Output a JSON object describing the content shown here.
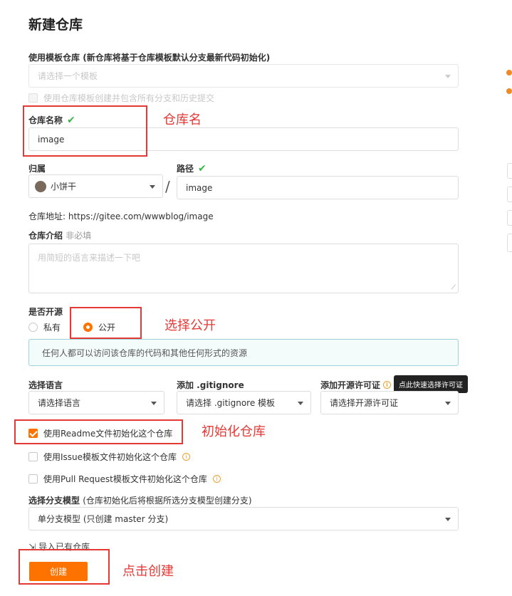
{
  "page": {
    "title": "新建仓库"
  },
  "template": {
    "label": "使用模板仓库",
    "hint": "(新仓库将基于仓库模板默认分支最新代码初始化)",
    "placeholder": "请选择一个模板",
    "include_all_label": "使用仓库模板创建并包含所有分支和历史提交"
  },
  "repo_name": {
    "label": "仓库名称",
    "value": "image"
  },
  "owner": {
    "label": "归属",
    "value": "小饼干"
  },
  "path": {
    "label": "路径",
    "value": "image"
  },
  "separator": "/",
  "address": {
    "label": "仓库地址:",
    "value": "https://gitee.com/wwwblog/image"
  },
  "intro": {
    "label": "仓库介绍",
    "optional": "非必填",
    "placeholder": "用简短的语言来描述一下吧"
  },
  "visibility": {
    "label": "是否开源",
    "private_label": "私有",
    "public_label": "公开",
    "selected": "public",
    "notice": "任何人都可以访问该仓库的代码和其他任何形式的资源"
  },
  "language": {
    "label": "选择语言",
    "placeholder": "请选择语言"
  },
  "gitignore": {
    "label": "添加 .gitignore",
    "placeholder": "请选择 .gitignore 模板"
  },
  "license": {
    "label": "添加开源许可证",
    "placeholder": "请选择开源许可证",
    "tooltip": "点此快速选择许可证"
  },
  "init_options": {
    "readme_label": "使用Readme文件初始化这个仓库",
    "readme_checked": true,
    "issue_label": "使用Issue模板文件初始化这个仓库",
    "issue_checked": false,
    "pr_label": "使用Pull Request模板文件初始化这个仓库",
    "pr_checked": false
  },
  "branch_model": {
    "label": "选择分支模型",
    "hint": "(仓库初始化后将根据所选分支模型创建分支)",
    "value": "单分支模型 (只创建 master 分支)"
  },
  "import_link": "导入已有仓库",
  "create_button": "创建",
  "annotations": {
    "repo_name": "仓库名",
    "public": "选择公开",
    "init": "初始化仓库",
    "create": "点击创建"
  },
  "colors": {
    "accent": "#fe7300",
    "success": "#3bb54a",
    "annotation": "#e53935"
  }
}
